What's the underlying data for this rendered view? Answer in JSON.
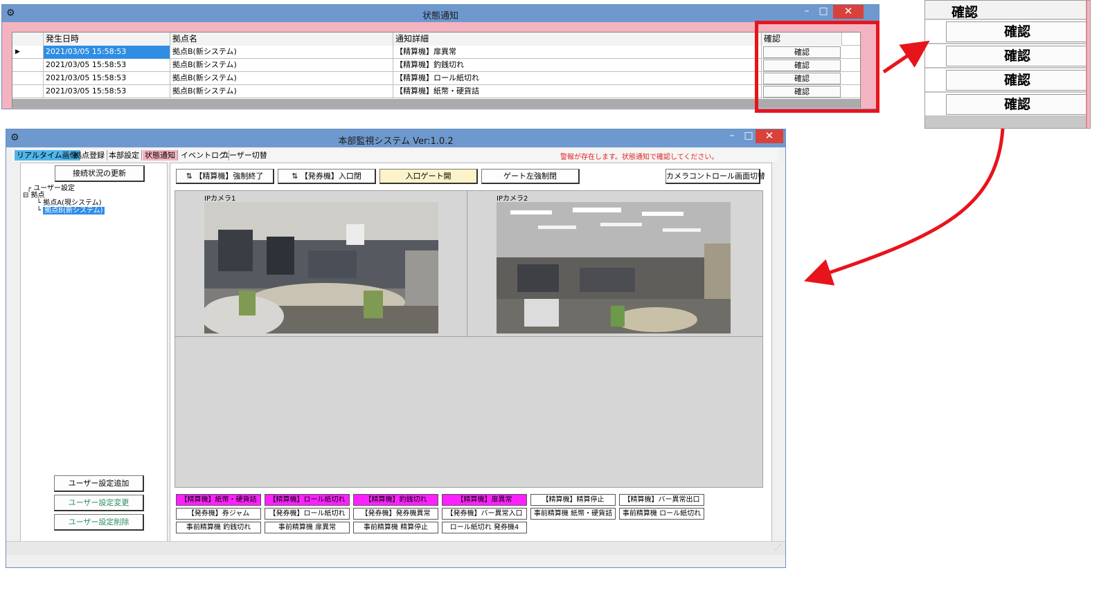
{
  "colors": {
    "titlebar": "#6e99cf",
    "notification_bg": "#f4b3c0",
    "highlight": "#e8141c",
    "selected": "#2f8de4",
    "alarm_active": "#ff20ff",
    "warning_text": "#e4231f",
    "tab_realtime": "#4fb6ea"
  },
  "notification_window": {
    "title": "状態通知",
    "app_icon": "app-icon",
    "columns": [
      "発生日時",
      "拠点名",
      "通知詳細",
      "確認"
    ],
    "rows": [
      {
        "datetime": "2021/03/05 15:58:53",
        "site": "拠点B(新システム)",
        "detail": "【精算機】扉異常",
        "action": "確認"
      },
      {
        "datetime": "2021/03/05 15:58:53",
        "site": "拠点B(新システム)",
        "detail": "【精算機】釣銭切れ",
        "action": "確認"
      },
      {
        "datetime": "2021/03/05 15:58:53",
        "site": "拠点B(新システム)",
        "detail": "【精算機】ロール紙切れ",
        "action": "確認"
      },
      {
        "datetime": "2021/03/05 15:58:53",
        "site": "拠点B(新システム)",
        "detail": "【精算機】紙幣・硬貨詰",
        "action": "確認"
      }
    ],
    "minimize": "–",
    "maximize": "□",
    "close": "✕"
  },
  "zoom_inset": {
    "header": "確認",
    "buttons": [
      "確認",
      "確認",
      "確認",
      "確認"
    ]
  },
  "main_window": {
    "title": "本部監視システム  Ver:1.0.2",
    "menu": [
      "リアルタイム画像",
      "拠点登録",
      "本部設定",
      "状態通知",
      "イベントログ",
      "ユーザー切替"
    ],
    "warning": "警報が存在します。状態通知で確認してください。",
    "refresh_button": "接続状況の更新",
    "tree": [
      {
        "label": "ユーザー設定",
        "level": 0
      },
      {
        "label": "拠点",
        "level": 0
      },
      {
        "label": "拠点A(現システム)",
        "level": 1
      },
      {
        "label": "拠点B(新システム)",
        "level": 1,
        "selected": true
      }
    ],
    "user_buttons": [
      "ユーザー設定追加",
      "ユーザー設定変更",
      "ユーザー設定削除"
    ],
    "toolbar": [
      {
        "label": "【精算機】強制終了",
        "icon": "arrows-icon"
      },
      {
        "label": "【発券機】入口閉",
        "icon": "arrows-icon"
      },
      {
        "label": "入口ゲート開",
        "icon": ""
      },
      {
        "label": "ゲート左強制閉",
        "icon": ""
      },
      {
        "label": "カメラコントロール画面切替",
        "icon": ""
      }
    ],
    "cameras": [
      "IPカメラ1",
      "IPカメラ2"
    ],
    "alarms": [
      [
        {
          "label": "【精算機】紙幣・硬貨詰",
          "active": true
        },
        {
          "label": "【精算機】ロール紙切れ",
          "active": true
        },
        {
          "label": "【精算機】釣銭切れ",
          "active": true
        },
        {
          "label": "【精算機】扉異常",
          "active": true
        },
        {
          "label": "【精算機】精算停止",
          "active": false
        },
        {
          "label": "【精算機】バー異常出口",
          "active": false
        }
      ],
      [
        {
          "label": "【発券機】券ジャム",
          "active": false
        },
        {
          "label": "【発券機】ロール紙切れ",
          "active": false
        },
        {
          "label": "【発券機】発券機異常",
          "active": false
        },
        {
          "label": "【発券機】バー異常入口",
          "active": false
        },
        {
          "label": "事前精算機 紙幣・硬貨詰",
          "active": false
        },
        {
          "label": "事前精算機 ロール紙切れ",
          "active": false
        }
      ],
      [
        {
          "label": "事前精算機 釣銭切れ",
          "active": false
        },
        {
          "label": "事前精算機 扉異常",
          "active": false
        },
        {
          "label": "事前精算機 精算停止",
          "active": false
        },
        {
          "label": "ロール紙切れ 発券機4",
          "active": false
        }
      ]
    ]
  }
}
